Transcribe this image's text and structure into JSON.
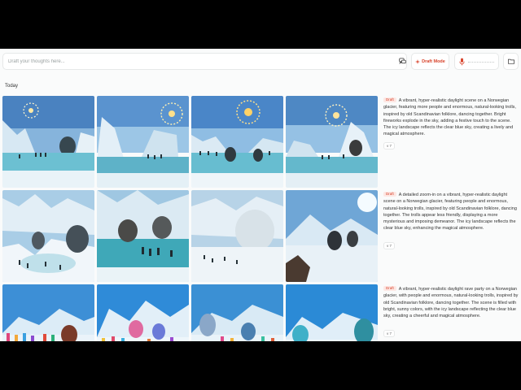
{
  "prompt": {
    "placeholder": "Draft your thoughts here..."
  },
  "mode": {
    "label": "Draft Mode"
  },
  "section": {
    "label": "Today"
  },
  "entries": [
    {
      "badge": "Draft",
      "text": "A vibrant, hyper-realistic daylight scene on a Norwegian glacier, featuring more people and enormous, natural-looking trolls, inspired by old Scandinavian folklore, dancing together. Bright fireworks explode in the sky, adding a festive touch to the scene. The icy landscape reflects the clear blue sky, creating a lively and magical atmosphere.",
      "version": "v 7"
    },
    {
      "badge": "Draft",
      "text": "A detailed zoom-in on a vibrant, hyper-realistic daylight scene on a Norwegian glacier, featuring people and enormous, natural-looking trolls, inspired by old Scandinavian folklore, dancing together. The trolls appear less friendly, displaying a more mysterious and imposing demeanor. The icy landscape reflects the clear blue sky, enhancing the magical atmosphere.",
      "version": "v 7"
    },
    {
      "badge": "Draft",
      "text": "A vibrant, hyper-realistic daylight rave party on a Norwegian glacier, with people and enormous, natural-looking trolls, inspired by old Scandinavian folklore, dancing together. The scene is filled with bright, sunny colors, with the icy landscape reflecting the clear blue sky, creating a cheerful and magical atmosphere.",
      "version": "v 7"
    }
  ],
  "colors": {
    "accent": "#d8432b",
    "badge_bg": "#fde8e4",
    "sky": "#4b86c6",
    "ice": "#cfe3ef",
    "water": "#5fb3c6"
  },
  "icons": [
    "chat-icon",
    "sparkle-icon",
    "mic-icon",
    "folder-icon"
  ]
}
